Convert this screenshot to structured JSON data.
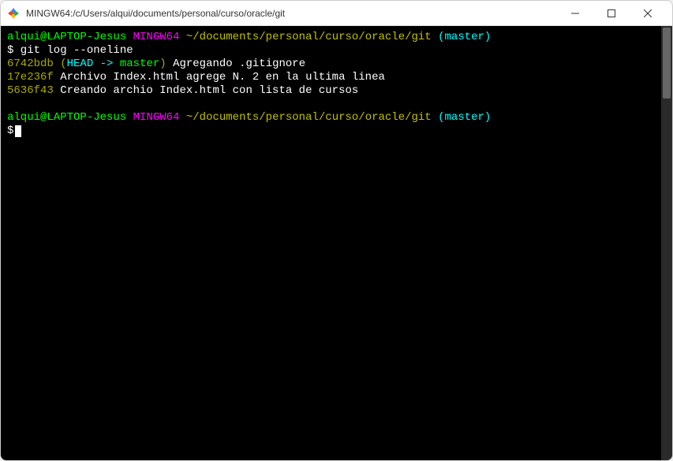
{
  "window": {
    "title": "MINGW64:/c/Users/alqui/documents/personal/curso/oracle/git"
  },
  "prompt1": {
    "user": "alqui@LAPTOP-Jesus",
    "env": "MINGW64",
    "path": "~/documents/personal/curso/oracle/git",
    "branch": "(master)"
  },
  "command1": "$ git log --oneline",
  "log": [
    {
      "hash": "6742bdb",
      "ref_open": " (",
      "ref_head": "HEAD -> ",
      "ref_branch": "master",
      "ref_close": ")",
      "message": " Agregando .gitignore"
    },
    {
      "hash": "17e236f",
      "message": " Archivo Index.html agrege N. 2 en la ultima linea"
    },
    {
      "hash": "5636f43",
      "message": " Creando archio Index.html con lista de cursos"
    }
  ],
  "prompt2": {
    "user": "alqui@LAPTOP-Jesus",
    "env": "MINGW64",
    "path": "~/documents/personal/curso/oracle/git",
    "branch": "(master)"
  },
  "command2": "$"
}
